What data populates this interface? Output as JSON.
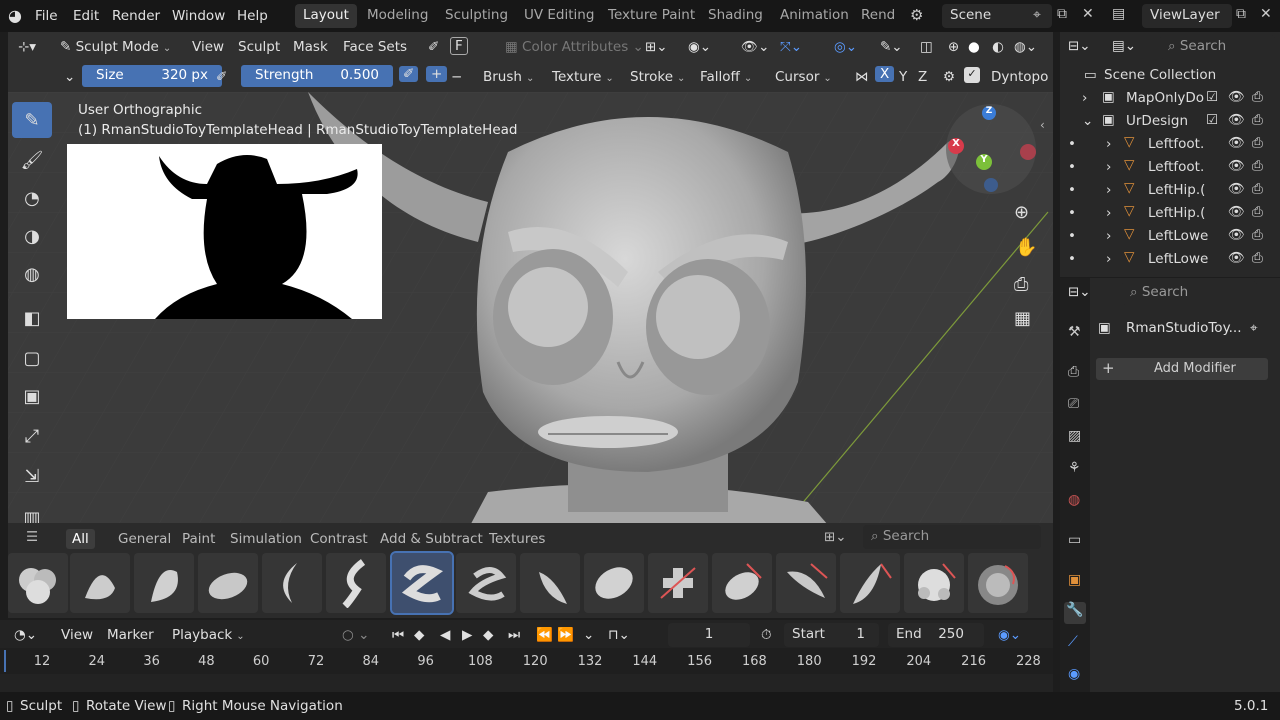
{
  "menu": {
    "file": "File",
    "edit": "Edit",
    "render": "Render",
    "window": "Window",
    "help": "Help"
  },
  "workspaces": [
    "Layout",
    "Modeling",
    "Sculpting",
    "UV Editing",
    "Texture Paint",
    "Shading",
    "Animation",
    "Rend"
  ],
  "scene": "Scene",
  "viewlayer": "ViewLayer",
  "vp_header": {
    "mode": "Sculpt Mode",
    "view": "View",
    "sculpt": "Sculpt",
    "mask": "Mask",
    "face_sets": "Face Sets",
    "f_key": "F",
    "color_attr": "Color Attributes"
  },
  "tool_settings": {
    "size_label": "Size",
    "size_value": "320 px",
    "strength_label": "Strength",
    "strength_value": "0.500",
    "brush": "Brush",
    "texture": "Texture",
    "stroke": "Stroke",
    "falloff": "Falloff",
    "cursor": "Cursor",
    "x": "X",
    "y": "Y",
    "z": "Z",
    "dyntopo": "Dyntopo"
  },
  "viewport": {
    "view_name": "User Orthographic",
    "object_info": "(1) RmanStudioToyTemplateHead | RmanStudioToyTemplateHead",
    "gizmo_x": "X",
    "gizmo_y": "Y",
    "gizmo_z": "Z"
  },
  "asset_tabs": [
    "All",
    "General",
    "Paint",
    "Simulation",
    "Contrast",
    "Add & Subtract",
    "Textures"
  ],
  "asset_search": "Search",
  "timeline": {
    "view": "View",
    "marker": "Marker",
    "playback": "Playback",
    "frame": "1",
    "start_label": "Start",
    "start": "1",
    "end_label": "End",
    "end": "250",
    "ticks": [
      "12",
      "24",
      "36",
      "48",
      "60",
      "72",
      "84",
      "96",
      "108",
      "120",
      "132",
      "144",
      "156",
      "168",
      "180",
      "192",
      "204",
      "216",
      "228"
    ]
  },
  "outliner": {
    "search": "Search",
    "root": "Scene Collection",
    "items": [
      "MapOnlyDo",
      "UrDesign",
      "Leftfoot.",
      "Leftfoot.",
      "LeftHip.(",
      "LeftHip.(",
      "LeftLowe",
      "LeftLowe"
    ]
  },
  "properties": {
    "search": "Search",
    "object": "RmanStudioToy...",
    "add_modifier": "Add Modifier"
  },
  "status": {
    "sculpt": "Sculpt",
    "rotate": "Rotate View",
    "nav": "Right Mouse Navigation",
    "version": "5.0.1"
  },
  "colors": {
    "accent": "#4772b3",
    "active_blue": "#4772b3"
  }
}
